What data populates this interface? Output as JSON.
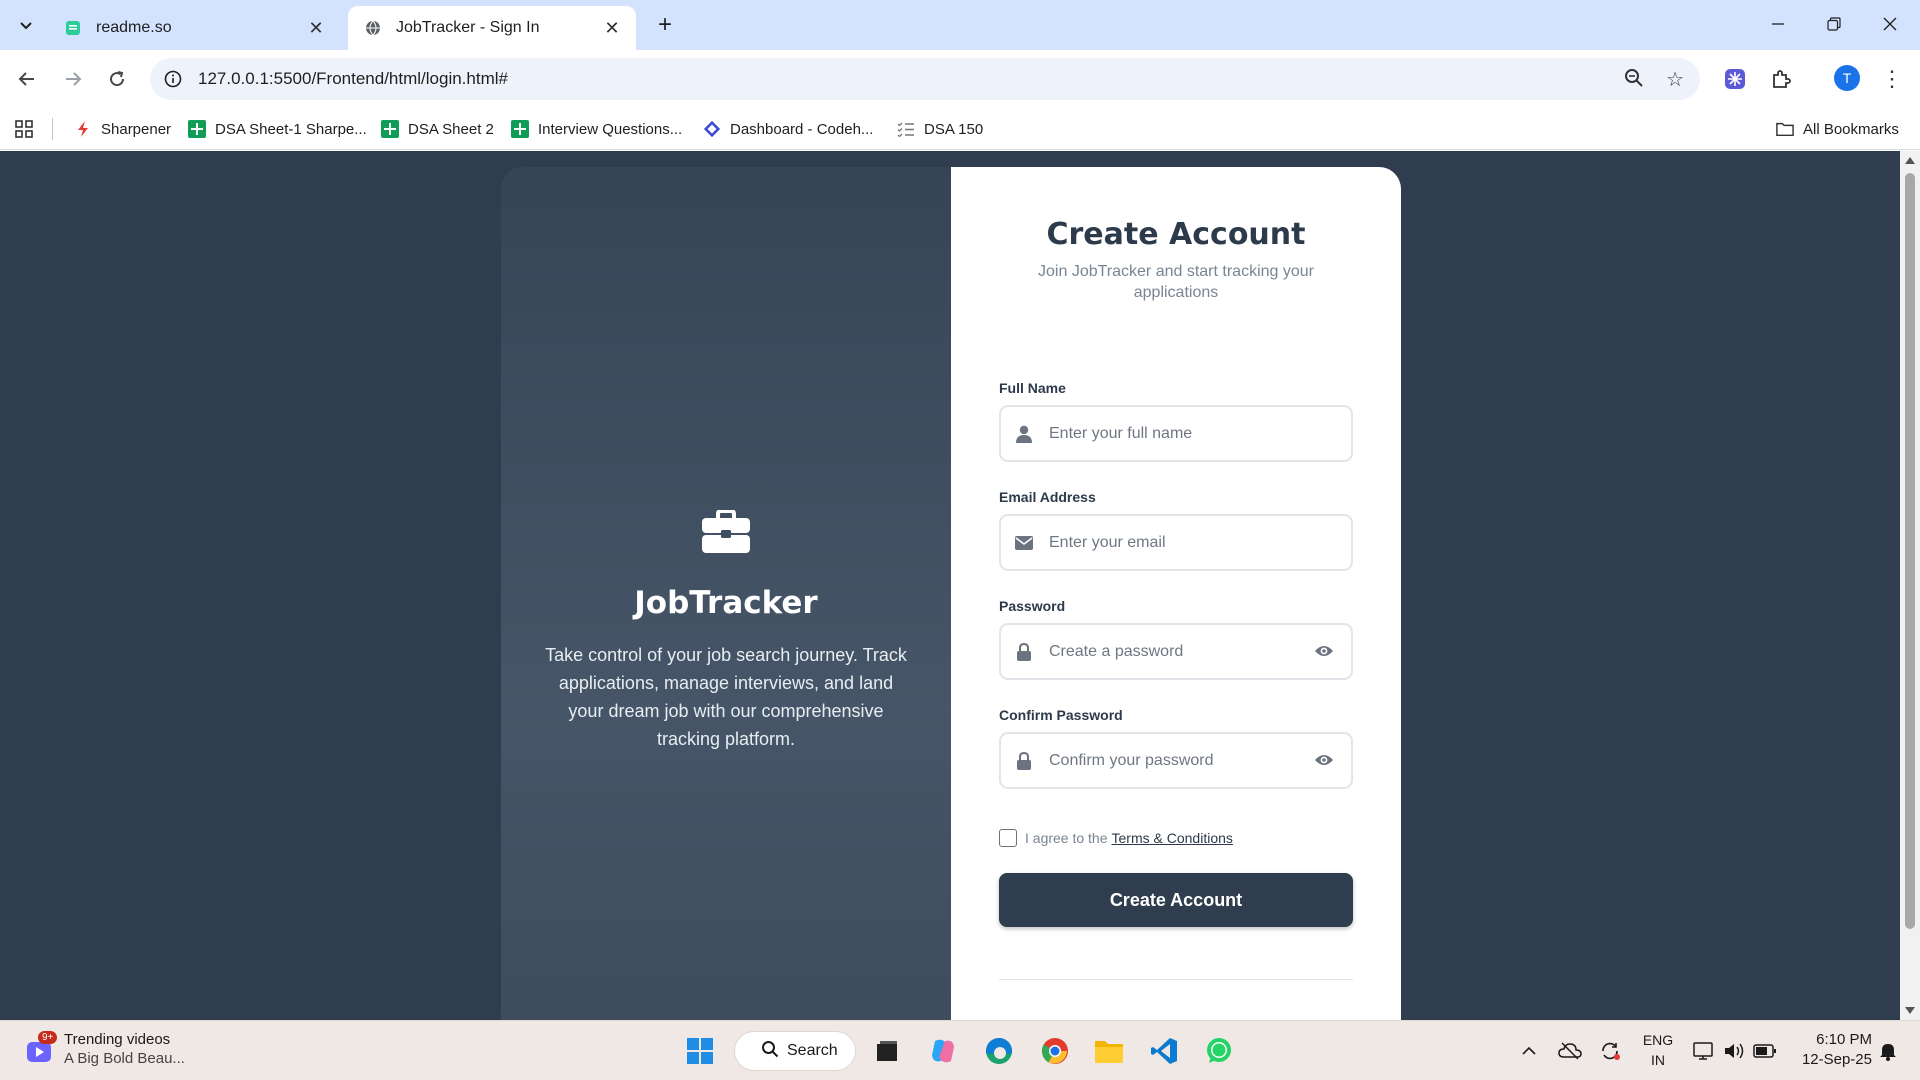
{
  "browser": {
    "tabs": [
      {
        "title": "readme.so"
      },
      {
        "title": "JobTracker - Sign In"
      }
    ],
    "url": "127.0.0.1:5500/Frontend/html/login.html#",
    "profile_initial": "T",
    "bookmarks": [
      {
        "label": "Sharpener"
      },
      {
        "label": "DSA Sheet-1 Sharpe..."
      },
      {
        "label": "DSA Sheet 2"
      },
      {
        "label": "Interview Questions..."
      },
      {
        "label": "Dashboard - Codeh..."
      },
      {
        "label": "DSA 150"
      }
    ],
    "all_bookmarks": "All Bookmarks"
  },
  "brand": {
    "title": "JobTracker",
    "description": "Take control of your job search journey. Track applications, manage interviews, and land your dream job with our comprehensive tracking platform."
  },
  "form": {
    "title": "Create Account",
    "subtitle": "Join JobTracker and start tracking your applications",
    "fields": [
      {
        "label": "Full Name",
        "placeholder": "Enter your full name",
        "icon": "user-icon"
      },
      {
        "label": "Email Address",
        "placeholder": "Enter your email",
        "icon": "envelope-icon"
      },
      {
        "label": "Password",
        "placeholder": "Create a password",
        "icon": "lock-icon"
      },
      {
        "label": "Confirm Password",
        "placeholder": "Confirm your password",
        "icon": "lock-icon"
      }
    ],
    "terms_prefix": "I agree to the",
    "terms_link": "Terms & Conditions",
    "submit": "Create Account"
  },
  "taskbar": {
    "news_title": "Trending videos",
    "news_sub": "A Big Bold Beau...",
    "news_badge": "9+",
    "search": "Search",
    "lang_line1": "ENG",
    "lang_line2": "IN",
    "time": "6:10 PM",
    "date": "12-Sep-25"
  },
  "colors": {
    "page_bg": "#2f3d4e",
    "button_bg": "#2f3d4e",
    "accent": "#1a73e8"
  }
}
